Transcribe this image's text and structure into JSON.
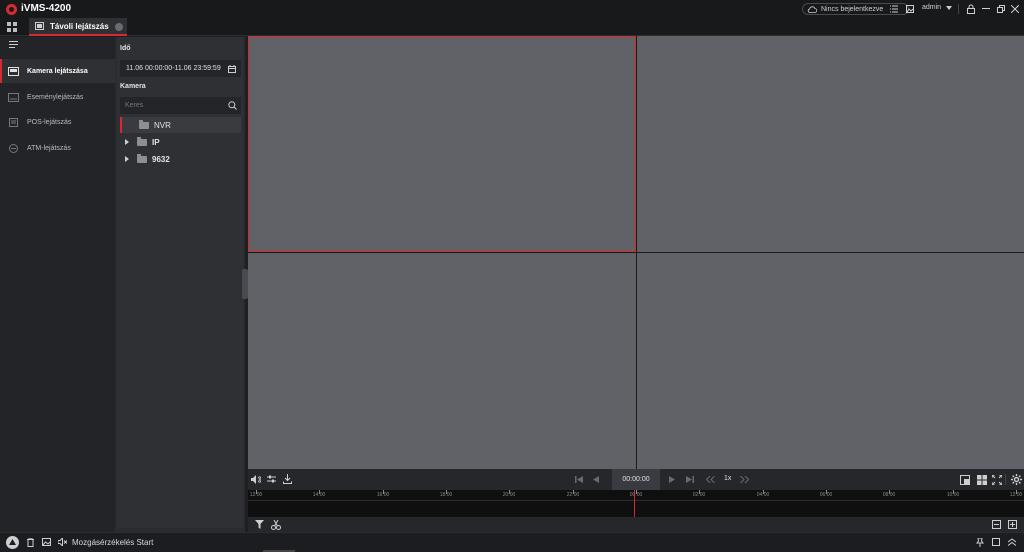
{
  "app": {
    "title": "iVMS-4200"
  },
  "titlebar": {
    "cloud_status": "Nincs bejelentkezve",
    "user": "admin"
  },
  "tabs": [
    {
      "label": "Távoli lejátszás"
    }
  ],
  "leftnav": {
    "items": [
      {
        "label": "Kamera lejátszása",
        "active": true
      },
      {
        "label": "Eseménylejátszás"
      },
      {
        "label": "POS-lejátszás"
      },
      {
        "label": "ATM-lejátszás"
      }
    ]
  },
  "panel": {
    "time_label": "Idő",
    "time_range": "11.06 00:00:00-11.06 23:59:59",
    "camera_label": "Kamera",
    "search_placeholder": "Keres",
    "tree": [
      {
        "label": "NVR",
        "expandable": false,
        "selected": true
      },
      {
        "label": "IP",
        "expandable": true
      },
      {
        "label": "9632",
        "expandable": true
      }
    ]
  },
  "playback": {
    "time": "00:00:00",
    "speed": "1x"
  },
  "timeline": {
    "labels": [
      "12:00",
      "14:00",
      "16:00",
      "18:00",
      "20:00",
      "22:00",
      "00:00",
      "02:00",
      "04:00",
      "06:00",
      "08:00",
      "10:00",
      "12:00"
    ],
    "cursor_label_index": 6
  },
  "statusbar": {
    "message": "Mozgásérzékelés Start"
  },
  "colors": {
    "accent": "#d62a2f",
    "cell": "#616267",
    "background": "#1e1f22"
  }
}
